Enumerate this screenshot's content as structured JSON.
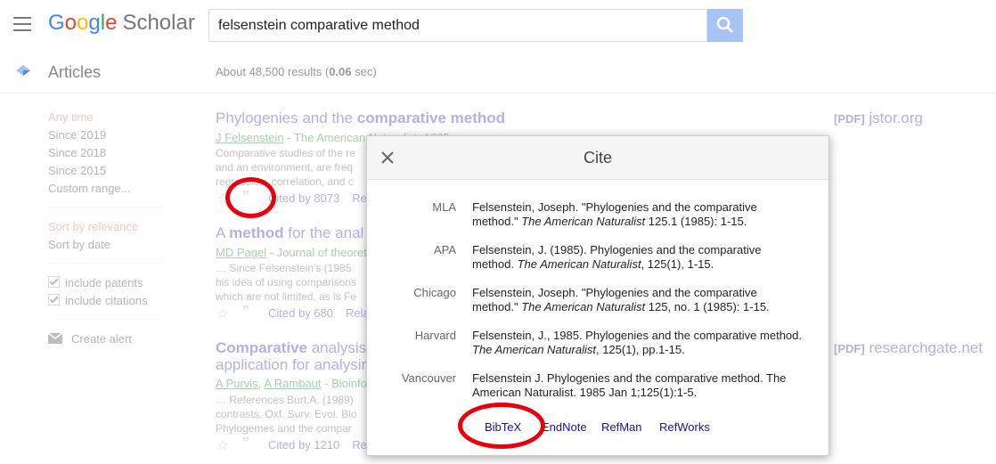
{
  "header": {
    "logo_google_letters": [
      "G",
      "o",
      "o",
      "g",
      "l",
      "e"
    ],
    "logo_suffix": "Scholar",
    "search_query": "felsenstein comparative method"
  },
  "subheader": {
    "section_label": "Articles",
    "result_stats_prefix": "About 48,500 results (",
    "result_stats_time": "0.06",
    "result_stats_suffix": " sec)"
  },
  "sidebar": {
    "time_filters": [
      "Any time",
      "Since 2019",
      "Since 2018",
      "Since 2015",
      "Custom range..."
    ],
    "sort_options": [
      "Sort by relevance",
      "Sort by date"
    ],
    "checkboxes": [
      "include patents",
      "include citations"
    ],
    "create_alert": "Create alert"
  },
  "results": [
    {
      "title_plain": "Phylogenies and the ",
      "title_bold": "comparative method",
      "author_link": "J Felsenstein",
      "source_rest": " - The American Naturalist, 1985",
      "snippet": [
        "Comparative studies of the re",
        "and an environment, are freq",
        "regression, correlation, and c"
      ],
      "cited_by": "Cited by 8073",
      "related": "Re",
      "pdf_tag": "[PDF]",
      "pdf_domain": "jstor.org"
    },
    {
      "title_pre": "A ",
      "title_bold": "method",
      "title_post": " for the anal",
      "author_link": "MD Pagel",
      "source_rest": " - Journal of theoret",
      "snippet": [
        "… Since Felsenstein's (1985",
        "his idea of using comparisons",
        "which are not limited, as is Fe"
      ],
      "cited_by": "Cited by 680",
      "related": "Rela"
    },
    {
      "title_line1_bold": "Comparative",
      "title_line1_rest": " analysis",
      "title_line2": "application for analysir",
      "author_links": [
        "A Purvis",
        "A Rambaut"
      ],
      "source_rest": " - Bioinfo",
      "snippet": [
        "… References Burt,A. (1989)",
        "contrasts. Oxf. Surv. Evol. Bio",
        "Phylogemes and the compar"
      ],
      "cited_by": "Cited by 1210",
      "related": "Re",
      "pdf_tag": "[PDF]",
      "pdf_domain": "researchgate.net"
    }
  ],
  "cite_dialog": {
    "title": "Cite",
    "citations": [
      {
        "style": "MLA",
        "text_pre": "Felsenstein, Joseph. \"Phylogenies and the comparative method.\" ",
        "journal": "The American Naturalist",
        "text_post": " 125.1 (1985): 1-15."
      },
      {
        "style": "APA",
        "text_pre": "Felsenstein, J. (1985). Phylogenies and the comparative method. ",
        "journal": "The American Naturalist",
        "text_post": ", 125(1), 1-15."
      },
      {
        "style": "Chicago",
        "text_pre": "Felsenstein, Joseph. \"Phylogenies and the comparative method.\" ",
        "journal": "The American Naturalist",
        "text_post": " 125, no. 1 (1985): 1-15."
      },
      {
        "style": "Harvard",
        "text_pre": "Felsenstein, J., 1985. Phylogenies and the comparative method. ",
        "journal": "The American Naturalist",
        "text_post": ", 125(1), pp.1-15."
      },
      {
        "style": "Vancouver",
        "text_pre": "Felsenstein J. Phylogenies and the comparative method. The American Naturalist. 1985 Jan 1;125(1):1-5.",
        "journal": "",
        "text_post": ""
      }
    ],
    "exports": [
      "BibTeX",
      "EndNote",
      "RefMan",
      "RefWorks"
    ]
  },
  "icons": [
    "menu-icon",
    "search-icon",
    "articles-icon",
    "star-icon",
    "quote-icon",
    "close-icon",
    "mail-icon",
    "checkbox-icon"
  ],
  "colors": {
    "annotation_ring": "#e8000b",
    "link": "#1a0dab",
    "author_green": "#006621",
    "active_filter": "#e7999a"
  }
}
